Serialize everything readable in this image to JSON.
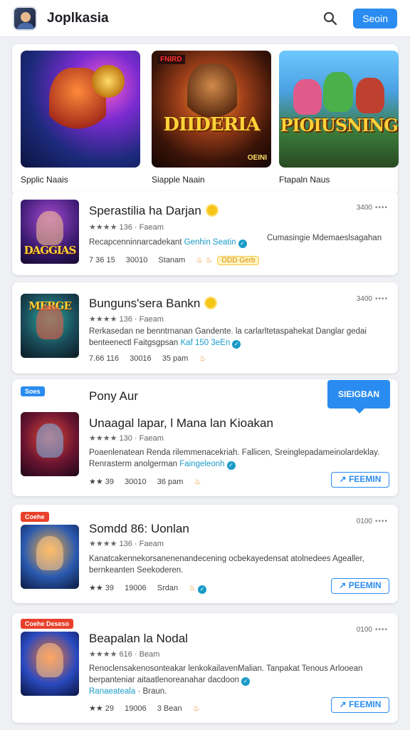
{
  "header": {
    "title": "Joplkasia",
    "button_label": "Seoin"
  },
  "featured": [
    {
      "label": "Spplic Naais",
      "art_text": ""
    },
    {
      "label": "Siapple Naain",
      "art_text": "DIIDERIA",
      "tag": "FNIRD",
      "tag2": "OEINI"
    },
    {
      "label": "Ftapaln Naus",
      "art_text": "PIOIUSNING"
    }
  ],
  "cards": [
    {
      "title": "Sperastilia ha Darjan",
      "thumb_text": "DAGGIAS",
      "rating": "★★★★ 136 · Faeam",
      "desc_line1": "Recapcenninnarcadekant",
      "desc_link1": "Genhin Seatin",
      "desc_right": "Cumasingie Mdemaeslsagahan",
      "meta": [
        "7 36 15",
        "30010",
        "Stanam"
      ],
      "pill": "ODD Gerb",
      "downloads": "3400"
    },
    {
      "title": "Bunguns'sera Bankn",
      "thumb_text": "MERGE",
      "rating": "★★★★ 136 · Faeam",
      "desc_line1": "Rerkasedan ne benntrnanan Gandente. la carlarltetaspahekat Danglar gedai",
      "desc_line2": "benteenectl Faitgsgpsan",
      "desc_link2": "Kaf 150 3eEn",
      "meta": [
        "7.66 116",
        "30016",
        "35 pam"
      ],
      "downloads": "3400"
    },
    {
      "promo": "Soes",
      "section_title": "Pony Aur",
      "callout": "SIEIGBAN",
      "title": "Unaagal lapar, l Mana lan Kioakan",
      "rating": "★★★★ 130 · Faeam",
      "desc_line1": "Poaenlenatean Renda rilemmenacekriah. Fallicen, Sreinglepadameinolardeklay.",
      "desc_line2": "Renrasterm anolgerman",
      "desc_link2": "Faingeleonh",
      "meta": [
        "★★ 39",
        "30010",
        "36 pam"
      ],
      "get_label": "FEEMIN"
    },
    {
      "promo": "Coehe",
      "title": "Somdd 86: Uonlan",
      "rating": "★★★★ 136 · Faeam",
      "desc_line1": "Kanatcakennekorsanenenandecening ocbekayedensat atolnedees Agealler,",
      "desc_line2": "bernkeanten Seekoderen.",
      "meta": [
        "★★ 39",
        "19006",
        "Srdan"
      ],
      "get_label": "PEEMIN",
      "downloads": "0100"
    },
    {
      "promo": "Coehe Deseso",
      "title": "Beapalan la Nodal",
      "rating": "★★★★ 616 · Beam",
      "desc_line1": "Renoclensakenosonteakar lenkokailavenMalian. Tanpakat Tenous Arlooean",
      "desc_line2": "berpanteniar aitaatlenoreanahar dacdoon",
      "desc_line3_link": "Ranaeateala",
      "desc_line3": "· Braun.",
      "meta": [
        "★★ 29",
        "19006",
        "3 Bean"
      ],
      "get_label": "FEEMIN",
      "downloads": "0100"
    }
  ]
}
